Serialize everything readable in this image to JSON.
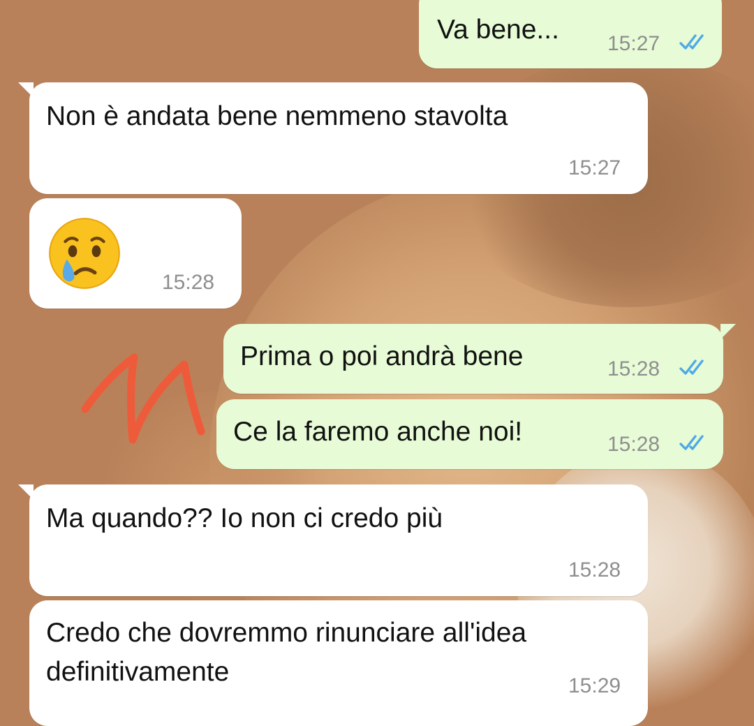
{
  "messages": [
    {
      "id": "m1",
      "direction": "outgoing",
      "text": "Va bene...",
      "time": "15:27",
      "status": "read"
    },
    {
      "id": "m2",
      "direction": "incoming",
      "text": "Non è andata bene nemmeno stavolta",
      "time": "15:27"
    },
    {
      "id": "m3",
      "direction": "incoming",
      "emoji": "crying-face",
      "time": "15:28"
    },
    {
      "id": "m4",
      "direction": "outgoing",
      "text": "Prima o poi andrà bene",
      "time": "15:28",
      "status": "read"
    },
    {
      "id": "m5",
      "direction": "outgoing",
      "text": "Ce la faremo anche noi!",
      "time": "15:28",
      "status": "read"
    },
    {
      "id": "m6",
      "direction": "incoming",
      "text": "Ma quando?? Io non ci credo più",
      "time": "15:28"
    },
    {
      "id": "m7",
      "direction": "incoming",
      "lines": [
        "Credo che dovremmo rinunciare all'idea",
        "definitivamente"
      ],
      "time": "15:29"
    }
  ],
  "icons": {
    "read_receipt": "double-check-icon",
    "annotation": "scribble-annotation"
  },
  "colors": {
    "incoming_bubble": "#ffffff",
    "outgoing_bubble": "#e7fcd6",
    "read_tick": "#4fa9e6",
    "annotation": "#ee5b3b",
    "timestamp": "#8e8e8e"
  }
}
